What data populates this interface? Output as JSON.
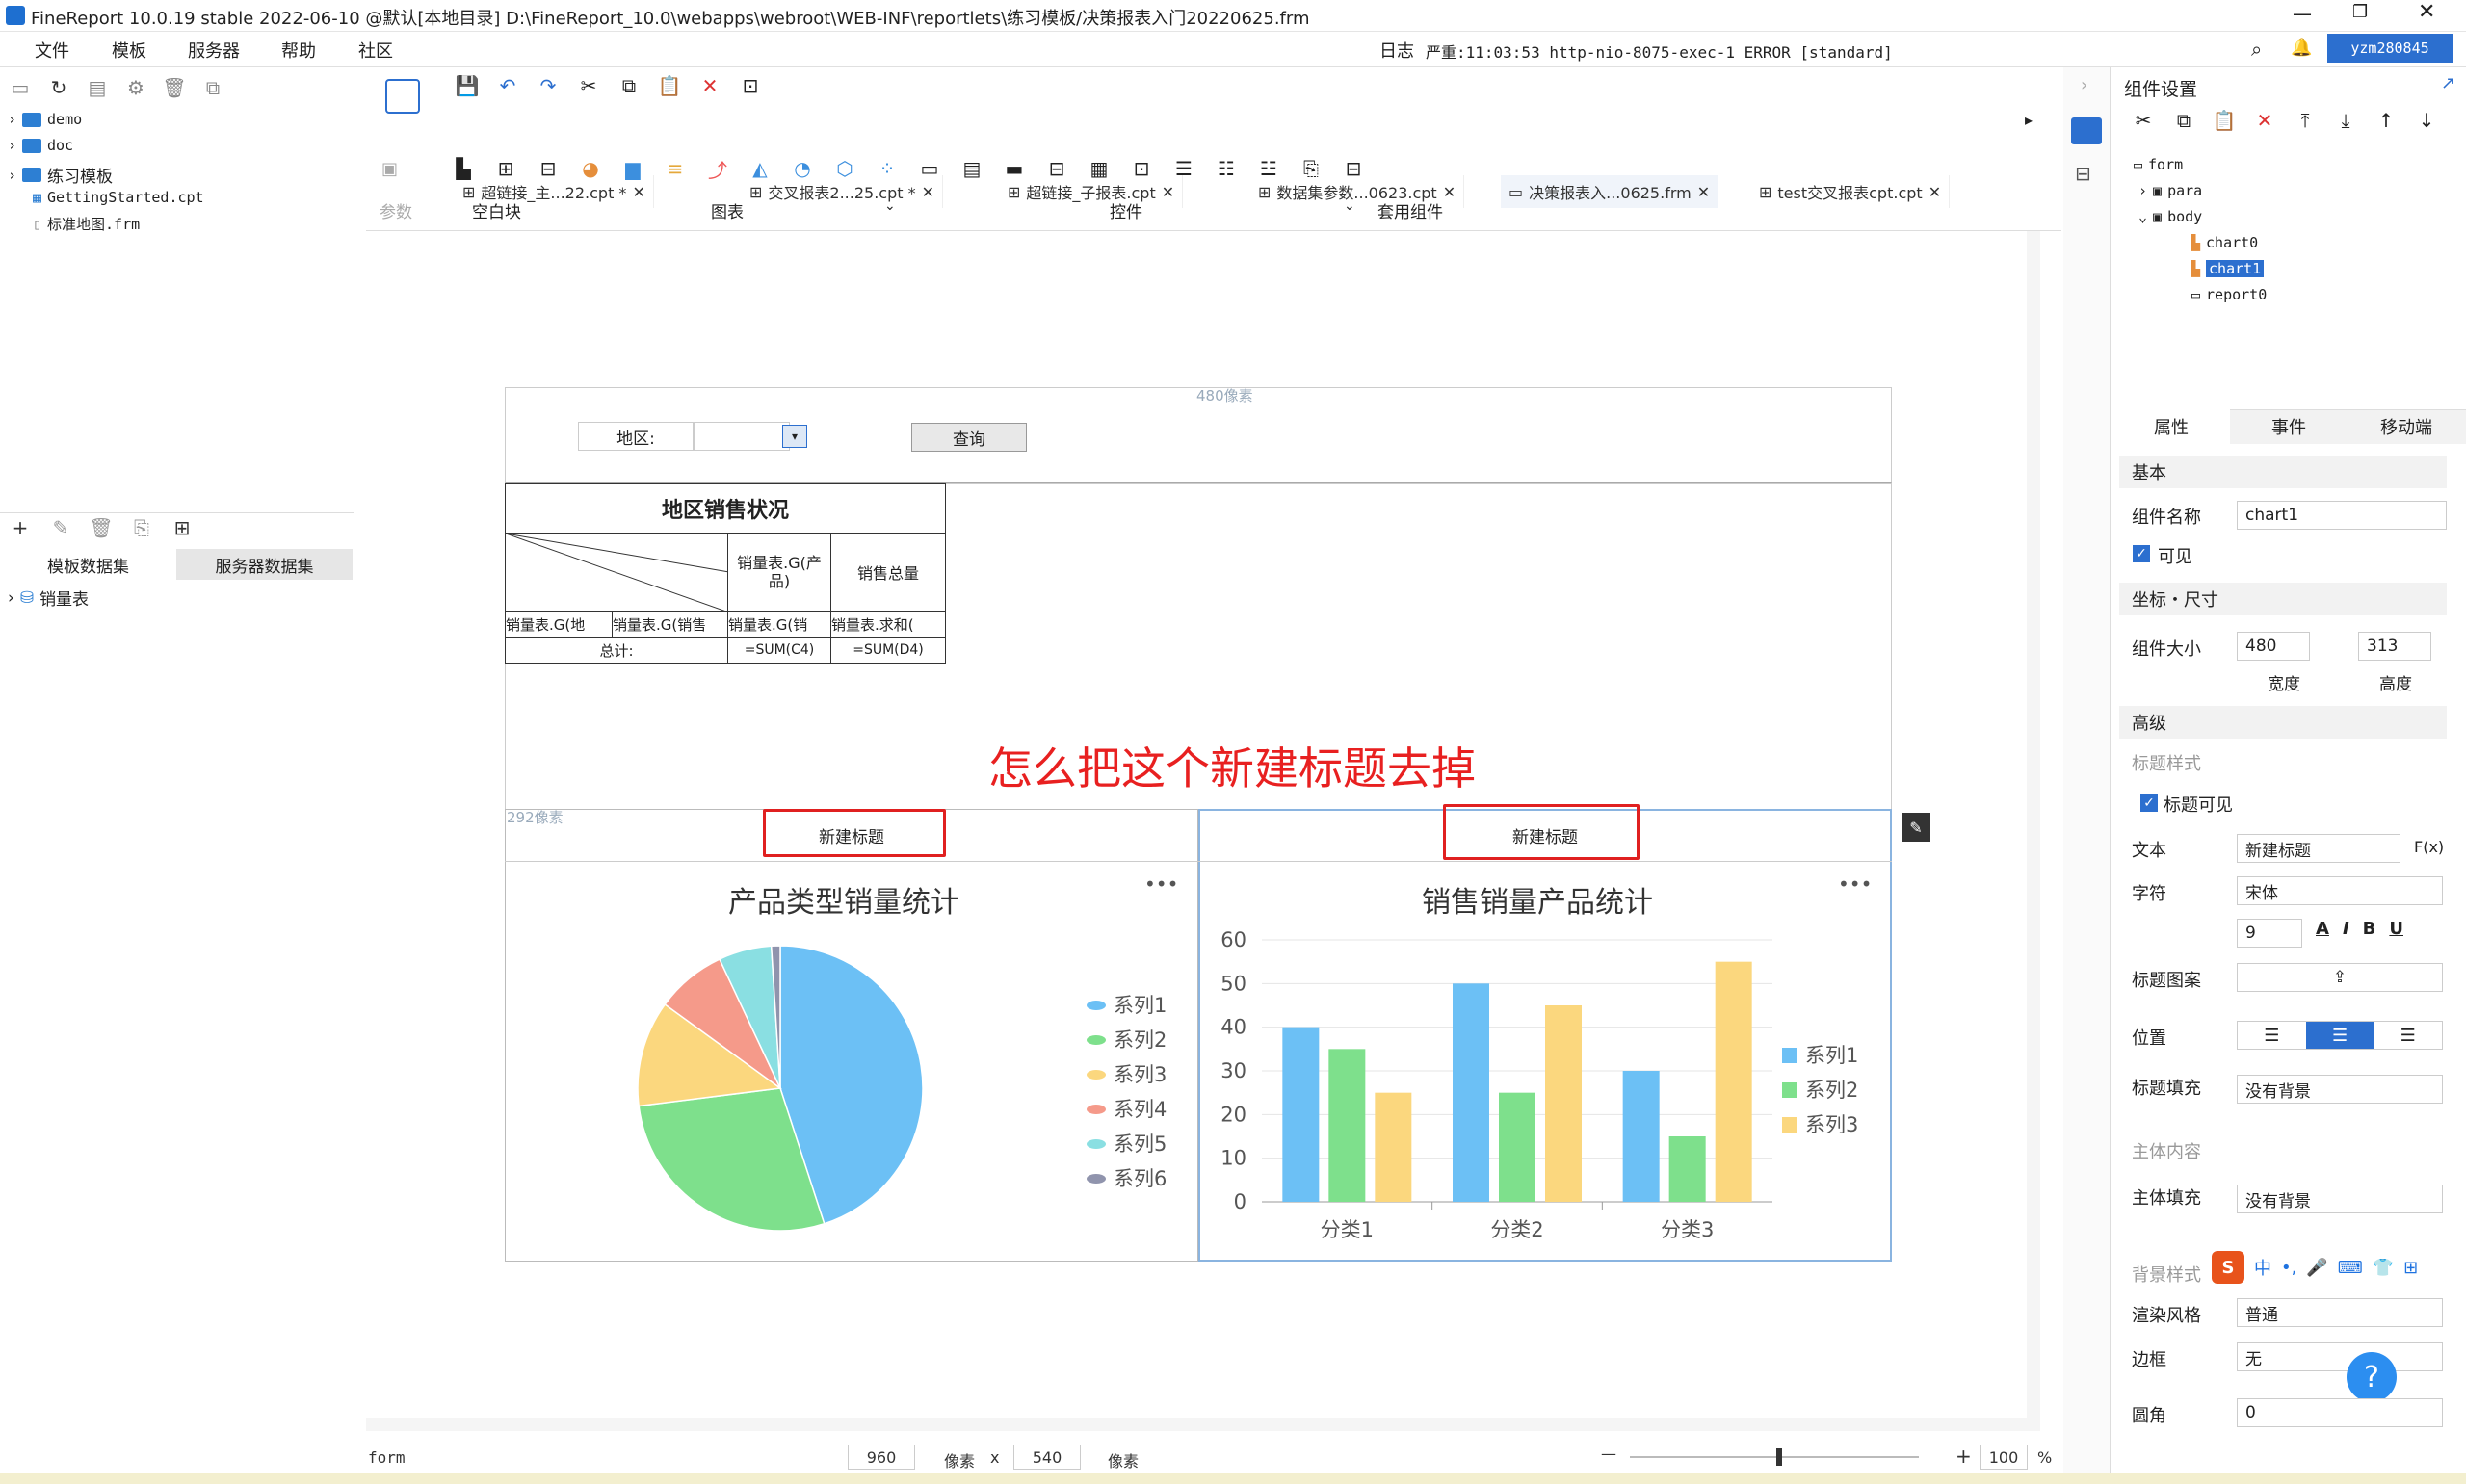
{
  "window": {
    "title": "FineReport 10.0.19 stable 2022-06-10 @默认[本地目录]    D:\\FineReport_10.0\\webapps\\webroot\\WEB-INF\\reportlets\\练习模板/决策报表入门20220625.frm"
  },
  "menu": [
    "文件",
    "模板",
    "服务器",
    "帮助",
    "社区"
  ],
  "status_line": {
    "log": "日志",
    "severity": "严重:11:03:53 http-nio-8075-exec-1 ERROR [standard]",
    "user": "yzm280845"
  },
  "file_tree": [
    {
      "label": "demo",
      "type": "folder"
    },
    {
      "label": "doc",
      "type": "folder"
    },
    {
      "label": "练习模板",
      "type": "folder"
    },
    {
      "label": "GettingStarted.cpt",
      "type": "file"
    },
    {
      "label": "标准地图.frm",
      "type": "file"
    }
  ],
  "dataset": {
    "tabs": [
      "模板数据集",
      "服务器数据集"
    ],
    "items": [
      "销量表"
    ]
  },
  "tabs": [
    {
      "label": "超链接_主...22.cpt *"
    },
    {
      "label": "交叉报表2...25.cpt *"
    },
    {
      "label": "超链接_子报表.cpt"
    },
    {
      "label": "数据集参数...0623.cpt"
    },
    {
      "label": "决策报表入...0625.frm",
      "active": true
    },
    {
      "label": "test交叉报表cpt.cpt"
    }
  ],
  "toolbar_groups": {
    "param": "参数",
    "blank": "空白块",
    "chart": "图表",
    "widget": "控件",
    "template_widget": "套用组件"
  },
  "canvas": {
    "width_marker": "480像素",
    "height_marker": "292像素",
    "param_label": "地区:",
    "query_button": "查询",
    "annotation": "怎么把这个新建标题去掉",
    "report": {
      "title": "地区销售状况",
      "header_cells": [
        "销量表.G(产品)",
        "销售总量"
      ],
      "row_cells": [
        "销量表.G(地",
        "销量表.G(销售",
        "销量表.G(销",
        "销量表.求和("
      ],
      "total_label": "总计:",
      "total_cells": [
        "=SUM(C4)",
        "=SUM(D4)"
      ]
    },
    "chart0": {
      "widget_title": "新建标题",
      "chart_title": "产品类型销量统计"
    },
    "chart1": {
      "widget_title": "新建标题",
      "chart_title": "销售销量产品统计"
    }
  },
  "chart_data": [
    {
      "type": "pie",
      "title": "产品类型销量统计",
      "series": [
        {
          "name": "系列1",
          "value": 45
        },
        {
          "name": "系列2",
          "value": 28
        },
        {
          "name": "系列3",
          "value": 12
        },
        {
          "name": "系列4",
          "value": 8
        },
        {
          "name": "系列5",
          "value": 6
        },
        {
          "name": "系列6",
          "value": 1
        }
      ],
      "colors": [
        "#6cc0f5",
        "#7ee08c",
        "#fbd77e",
        "#f59a8a",
        "#8adfe2",
        "#9094ad"
      ],
      "legend": "right"
    },
    {
      "type": "bar",
      "title": "销售销量产品统计",
      "categories": [
        "分类1",
        "分类2",
        "分类3"
      ],
      "series": [
        {
          "name": "系列1",
          "values": [
            40,
            50,
            30
          ]
        },
        {
          "name": "系列2",
          "values": [
            35,
            25,
            15
          ]
        },
        {
          "name": "系列3",
          "values": [
            25,
            45,
            55
          ]
        }
      ],
      "colors": [
        "#6cc0f5",
        "#7ee08c",
        "#fbd77e"
      ],
      "ylim": [
        0,
        60
      ],
      "yticks": [
        "0",
        "10",
        "20",
        "30",
        "40",
        "50",
        "60"
      ],
      "legend": "right"
    }
  ],
  "statusbar": {
    "form": "form",
    "width": "960",
    "unit1": "像素",
    "x": "x",
    "height": "540",
    "unit2": "像素",
    "zoom": "100",
    "pct": "%"
  },
  "right_panel": {
    "title": "组件设置",
    "tree": [
      "form",
      "para",
      "body",
      "chart0",
      "chart1",
      "report0"
    ],
    "prop_tabs": [
      "属性",
      "事件",
      "移动端"
    ],
    "sections": {
      "basic": "基本",
      "coord": "坐标・尺寸",
      "advanced": "高级"
    },
    "fields": {
      "name_label": "组件名称",
      "name_value": "chart1",
      "visible": "可见",
      "size_label": "组件大小",
      "width_value": "480",
      "height_value": "313",
      "width_caption": "宽度",
      "height_caption": "高度",
      "title_style": "标题样式",
      "title_visible": "标题可见",
      "text_label": "文本",
      "text_value": "新建标题",
      "font_label": "字符",
      "font_value": "宋体",
      "font_size": "9",
      "title_pattern": "标题图案",
      "position_label": "位置",
      "title_fill_label": "标题填充",
      "title_fill_value": "没有背景",
      "body_content": "主体内容",
      "body_fill_label": "主体填充",
      "body_fill_value": "没有背景",
      "bg_style": "背景样式",
      "render_label": "渲染风格",
      "render_value": "普通",
      "border_label": "边框",
      "border_value": "无",
      "radius_label": "圆角",
      "radius_value": "0",
      "fx": "F(x)"
    }
  }
}
